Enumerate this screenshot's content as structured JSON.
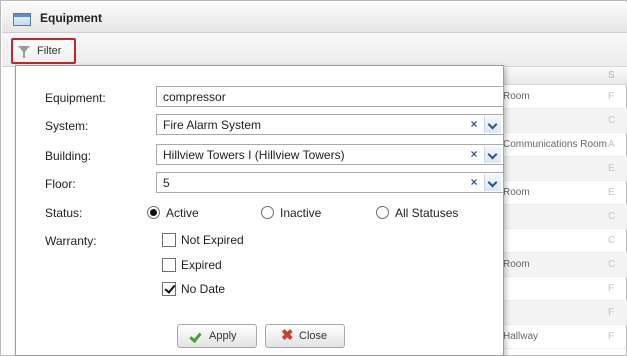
{
  "window": {
    "title": "Equipment"
  },
  "toolbar": {
    "filter_label": "Filter"
  },
  "grid": {
    "header_right": "S",
    "rows": [
      {
        "location": "Room",
        "status": "F"
      },
      {
        "location": "",
        "status": "C"
      },
      {
        "location": "Communications Room",
        "status": "A"
      },
      {
        "location": "",
        "status": "E"
      },
      {
        "location": "Room",
        "status": "E"
      },
      {
        "location": "",
        "status": "C"
      },
      {
        "location": "",
        "status": "C"
      },
      {
        "location": "Room",
        "status": "C"
      },
      {
        "location": "",
        "status": "F"
      },
      {
        "location": "",
        "status": "F"
      },
      {
        "location": "Hallway",
        "status": "F"
      }
    ]
  },
  "filter": {
    "equipment": {
      "label": "Equipment:",
      "value": "compressor"
    },
    "system": {
      "label": "System:",
      "value": "Fire Alarm System"
    },
    "building": {
      "label": "Building:",
      "value": "Hillview Towers I (Hillview Towers)"
    },
    "floor": {
      "label": "Floor:",
      "value": "5"
    },
    "clear_glyph": "×",
    "status": {
      "label": "Status:",
      "options": [
        "Active",
        "Inactive",
        "All Statuses"
      ],
      "selected": "Active"
    },
    "warranty": {
      "label": "Warranty:",
      "options": [
        "Not Expired",
        "Expired",
        "No Date"
      ],
      "checked": [
        "No Date"
      ]
    },
    "apply_label": "Apply",
    "close_label": "Close"
  },
  "colors": {
    "highlight_border": "#c0262c",
    "apply_icon": "#3fa33a",
    "close_icon": "#d33b2c"
  }
}
